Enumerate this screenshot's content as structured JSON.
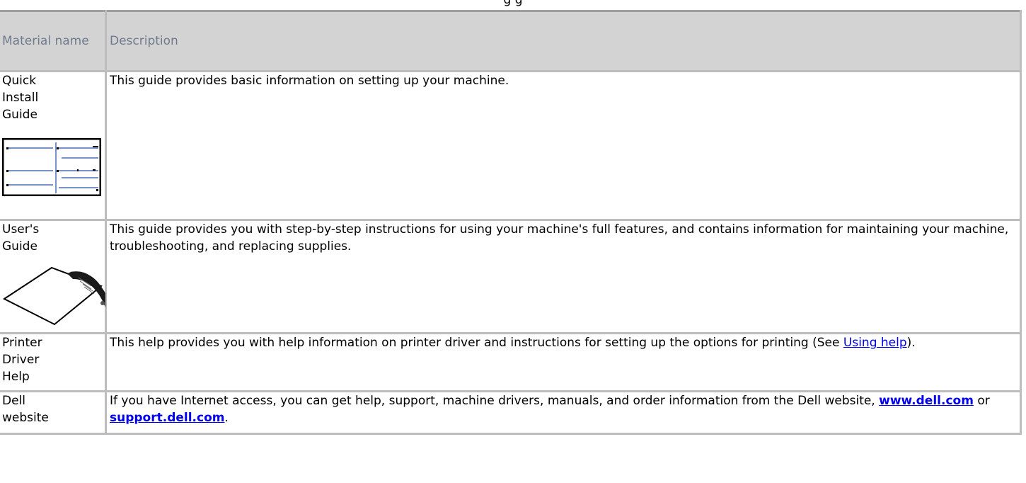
{
  "top_text": "g                                                                              g",
  "table": {
    "header": {
      "name": "Material name",
      "description": "Description"
    },
    "rows": [
      {
        "name": "Quick Install Guide",
        "description": "This guide provides basic information on setting up your machine.",
        "thumbnail": "quick-install-guide-thumbnail"
      },
      {
        "name": "User's Guide",
        "description": "This guide provides you with step-by-step instructions for using your machine's full features, and contains information for maintaining your machine, troubleshooting, and replacing supplies.",
        "thumbnail": "cd-sleeve-thumbnail"
      },
      {
        "name": "Printer Driver Help",
        "description_before": "This help provides you with help information on printer driver and instructions for setting up the options for printing (See ",
        "link": "Using help",
        "description_after": ")."
      },
      {
        "name": "Dell website",
        "description_before": "If you have Internet access, you can get help, support, machine drivers, manuals, and order information from the Dell website, ",
        "link1": "www.dell.com",
        "middle": " or ",
        "link2": "support.dell.com",
        "description_after": "."
      }
    ]
  },
  "colors": {
    "header_bg": "#d3d3d3",
    "header_text": "#6f7b8d",
    "link": "#0000ee",
    "border": "#bdbdbd"
  }
}
